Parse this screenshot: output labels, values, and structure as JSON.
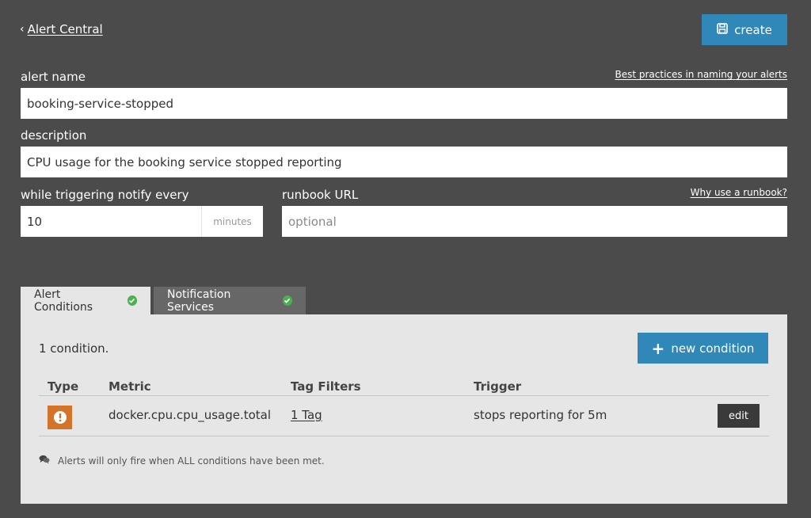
{
  "header": {
    "back_label": "Alert Central",
    "create_label": "create"
  },
  "form": {
    "alert_name_label": "alert name",
    "naming_help": "Best practices in naming your alerts",
    "alert_name_value": "booking-service-stopped",
    "description_label": "description",
    "description_value": "CPU usage for the booking service stopped reporting",
    "notify_label": "while triggering notify every",
    "notify_value": "10",
    "notify_unit": "minutes",
    "runbook_label": "runbook URL",
    "runbook_help": "Why use a runbook?",
    "runbook_placeholder": "optional"
  },
  "tabs": [
    {
      "label": "Alert Conditions",
      "active": true,
      "status": "check"
    },
    {
      "label": "Notification Services",
      "active": false,
      "status": "check"
    }
  ],
  "conditions": {
    "count_text": "1 condition.",
    "new_label": "new condition",
    "columns": [
      "Type",
      "Metric",
      "Tag Filters",
      "Trigger"
    ],
    "rows": [
      {
        "type_icon": "warning-icon",
        "metric": "docker.cpu.cpu_usage.total",
        "tag_filters": "1 Tag",
        "trigger": "stops reporting for 5m",
        "edit_label": "edit"
      }
    ],
    "footnote": "Alerts will only fire when ALL conditions have been met."
  },
  "colors": {
    "background": "#4b4b4b",
    "accent": "#2f88b8",
    "panel": "#e6e6e6",
    "success": "#4cb050",
    "warning": "#d4742a"
  }
}
